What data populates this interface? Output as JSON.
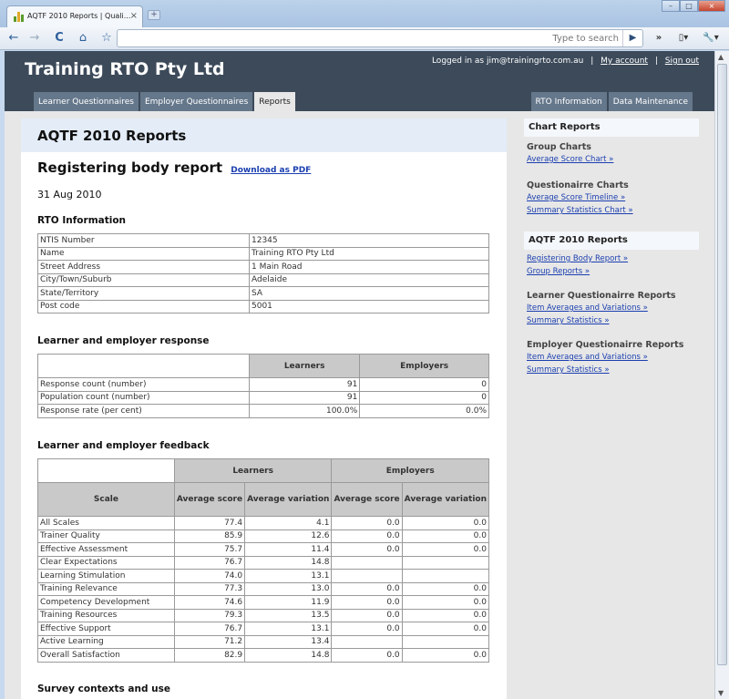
{
  "browser": {
    "tab_title": "AQTF 2010 Reports | Quali...",
    "tab_close": "×",
    "new_tab": "+",
    "window_buttons": [
      "–",
      "□",
      "×"
    ],
    "toolbar": {
      "back": "←",
      "forward": "→",
      "reload": "C",
      "home": "⌂",
      "star": "☆",
      "search_placeholder": "Type to search",
      "go": "▶",
      "overflow": "»",
      "page_menu": "▯▾",
      "tools_menu": "🔧▾"
    }
  },
  "site": {
    "brand": "Training RTO Pty Ltd",
    "login_prefix": "Logged in as jim@trainingrto.com.au",
    "my_account": "My account",
    "sign_out": "Sign out",
    "sep": "|",
    "nav_left": [
      "Learner Questionnaires",
      "Employer Questionnaires",
      "Reports"
    ],
    "nav_right": [
      "RTO Information",
      "Data Maintenance"
    ],
    "active_tab": "Reports"
  },
  "main": {
    "title": "AQTF 2010 Reports",
    "report_title": "Registering body report",
    "download_link": "Download as PDF",
    "date": "31 Aug 2010",
    "rto_info_heading": "RTO Information",
    "rto_info": [
      [
        "NTIS Number",
        "12345"
      ],
      [
        "Name",
        "Training RTO Pty Ltd"
      ],
      [
        "Street Address",
        "1 Main Road"
      ],
      [
        "City/Town/Suburb",
        "Adelaide"
      ],
      [
        "State/Territory",
        "SA"
      ],
      [
        "Post code",
        "5001"
      ]
    ],
    "response_heading": "Learner and employer response",
    "response_cols": [
      "Learners",
      "Employers"
    ],
    "response_rows": [
      [
        "Response count (number)",
        "91",
        "0"
      ],
      [
        "Population count (number)",
        "91",
        "0"
      ],
      [
        "Response rate (per cent)",
        "100.0%",
        "0.0%"
      ]
    ],
    "feedback_heading": "Learner and employer feedback",
    "feedback_groups": [
      "Learners",
      "Employers"
    ],
    "feedback_scale_label": "Scale",
    "feedback_subcols": [
      "Average score",
      "Average variation",
      "Average score",
      "Average variation"
    ],
    "feedback_rows": [
      [
        "All Scales",
        "77.4",
        "4.1",
        "0.0",
        "0.0"
      ],
      [
        "Trainer Quality",
        "85.9",
        "12.6",
        "0.0",
        "0.0"
      ],
      [
        "Effective Assessment",
        "75.7",
        "11.4",
        "0.0",
        "0.0"
      ],
      [
        "Clear Expectations",
        "76.7",
        "14.8",
        "",
        ""
      ],
      [
        "Learning Stimulation",
        "74.0",
        "13.1",
        "",
        ""
      ],
      [
        "Training Relevance",
        "77.3",
        "13.0",
        "0.0",
        "0.0"
      ],
      [
        "Competency Development",
        "74.6",
        "11.9",
        "0.0",
        "0.0"
      ],
      [
        "Training Resources",
        "79.3",
        "13.5",
        "0.0",
        "0.0"
      ],
      [
        "Effective Support",
        "76.7",
        "13.1",
        "0.0",
        "0.0"
      ],
      [
        "Active Learning",
        "71.2",
        "13.4",
        "",
        ""
      ],
      [
        "Overall Satisfaction",
        "82.9",
        "14.8",
        "0.0",
        "0.0"
      ]
    ],
    "survey_heading": "Survey contexts and use"
  },
  "sidebar": {
    "chart_reports": "Chart Reports",
    "group_charts": "Group Charts",
    "group_links": [
      "Average Score Chart »"
    ],
    "questionnaire_charts": "Questionairre Charts",
    "questionnaire_links": [
      "Average Score Timeline »",
      "Summary Statistics Chart »"
    ],
    "aqtf_reports": "AQTF 2010 Reports",
    "aqtf_links": [
      "Registering Body Report »",
      "Group Reports »"
    ],
    "learner_reports": "Learner Questionairre Reports",
    "learner_links": [
      "Item Averages and Variations »",
      "Summary Statistics »"
    ],
    "employer_reports": "Employer Questionairre Reports",
    "employer_links": [
      "Item Averages and Variations »",
      "Summary Statistics »"
    ]
  }
}
